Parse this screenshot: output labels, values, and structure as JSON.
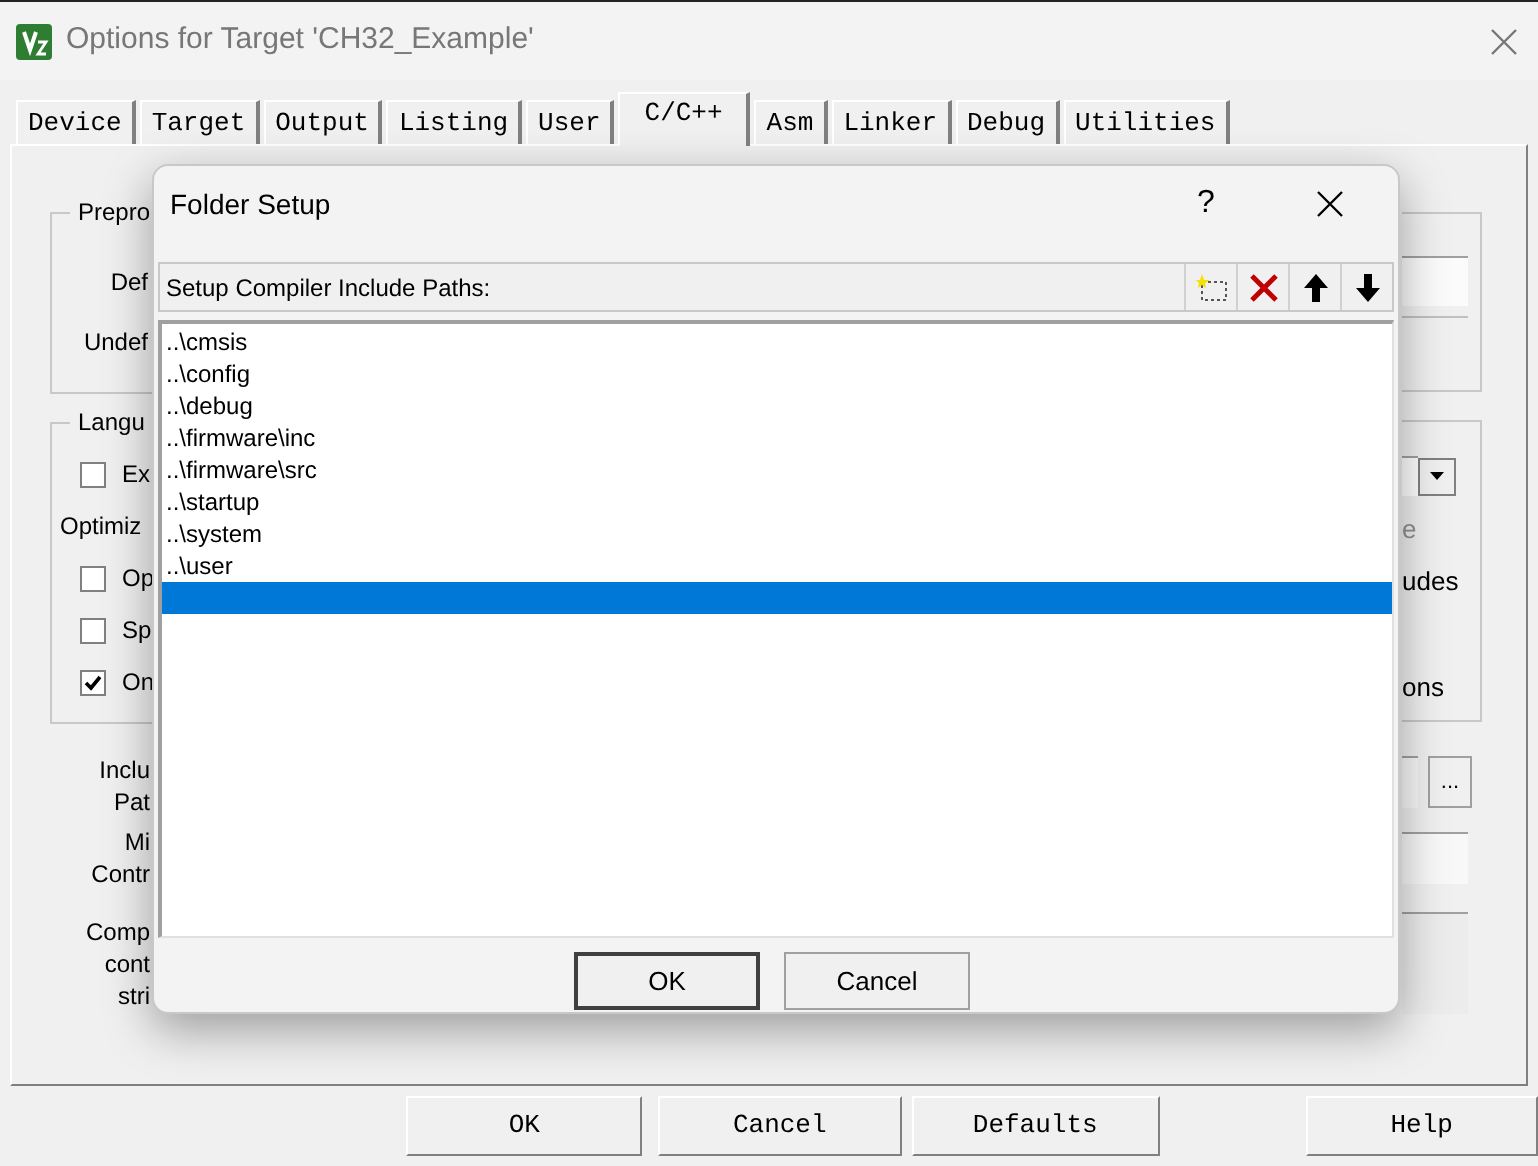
{
  "window": {
    "title": "Options for Target 'CH32_Example'"
  },
  "tabs": [
    {
      "label": "Device",
      "selected": false
    },
    {
      "label": "Target",
      "selected": false
    },
    {
      "label": "Output",
      "selected": false
    },
    {
      "label": "Listing",
      "selected": false
    },
    {
      "label": "User",
      "selected": false
    },
    {
      "label": "C/C++",
      "selected": true
    },
    {
      "label": "Asm",
      "selected": false
    },
    {
      "label": "Linker",
      "selected": false
    },
    {
      "label": "Debug",
      "selected": false
    },
    {
      "label": "Utilities",
      "selected": false
    }
  ],
  "left_column": {
    "preprocessor_group": {
      "legend": "Prepro",
      "labels": [
        "Def",
        "Undef"
      ]
    },
    "language_group": {
      "legend": "Langu",
      "rows": [
        {
          "kind": "checkbox",
          "label": "Ex",
          "checked": false
        },
        {
          "kind": "label",
          "label": "Optimiz"
        },
        {
          "kind": "checkbox",
          "label": "Op",
          "checked": false
        },
        {
          "kind": "checkbox",
          "label": "Sp",
          "checked": false
        },
        {
          "kind": "checkbox",
          "label": "On",
          "checked": true
        }
      ]
    },
    "field_labels": [
      [
        "Inclu",
        "Pat"
      ],
      [
        "Mi",
        "Contr"
      ],
      [
        "Comp",
        "cont",
        "stri"
      ]
    ]
  },
  "right_column": {
    "language_texts": [
      {
        "text": "e",
        "disabled": true
      },
      {
        "text": "udes",
        "disabled": false
      },
      {
        "text": "ons",
        "disabled": false
      }
    ],
    "browse_button": "..."
  },
  "folder_setup": {
    "title": "Folder Setup",
    "help": "?",
    "header_label": "Setup Compiler Include Paths:",
    "paths": [
      {
        "text": "..\\cmsis",
        "selected": false
      },
      {
        "text": "..\\config",
        "selected": false
      },
      {
        "text": "..\\debug",
        "selected": false
      },
      {
        "text": "..\\firmware\\inc",
        "selected": false
      },
      {
        "text": "..\\firmware\\src",
        "selected": false
      },
      {
        "text": "..\\startup",
        "selected": false
      },
      {
        "text": "..\\system",
        "selected": false
      },
      {
        "text": "..\\user",
        "selected": false
      }
    ],
    "new_entry": {
      "selected": true
    },
    "buttons": [
      "OK",
      "Cancel"
    ]
  },
  "buttons": [
    "OK",
    "Cancel",
    "Defaults",
    "Help"
  ]
}
